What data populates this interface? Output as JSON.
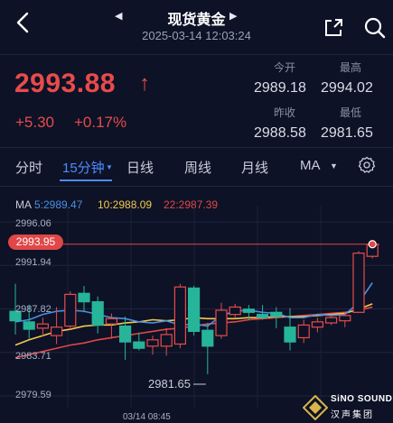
{
  "header": {
    "title": "现货黄金",
    "datetime": "2025-03-14 12:03:24",
    "icons": [
      "back-icon",
      "prev-triangle-icon",
      "next-triangle-icon",
      "share-icon",
      "search-icon"
    ]
  },
  "quote": {
    "price": "2993.88",
    "arrow": "↑",
    "change": "+5.30",
    "change_pct": "+0.17%",
    "up_color": "#e84b4b",
    "open_label": "今开",
    "open_value": "2989.18",
    "high_label": "最高",
    "high_value": "2994.02",
    "prev_close_label": "昨收",
    "prev_close_value": "2988.58",
    "low_label": "最低",
    "low_value": "2981.65"
  },
  "tabs": [
    {
      "label": "分时",
      "active": false
    },
    {
      "label": "15分钟",
      "active": true
    },
    {
      "label": "日线",
      "active": false
    },
    {
      "label": "周线",
      "active": false
    },
    {
      "label": "月线",
      "active": false
    },
    {
      "label": "MA",
      "active": false
    }
  ],
  "settings_icon": "gear-icon",
  "ma_legend": {
    "ma": "MA",
    "ma5": "5:2989.47",
    "ma10": "10:2988.09",
    "ma22": "22:2987.39",
    "colors": {
      "ma5": "#4a90e2",
      "ma10": "#f2c94c",
      "ma22": "#e14747"
    }
  },
  "chart_data": {
    "type": "candlestick",
    "y_ticks": [
      "2996.06",
      "2991.94",
      "2987.82",
      "2983.71",
      "2979.59"
    ],
    "ylim": [
      2979.59,
      2996.06
    ],
    "current_price_label": "2993.95",
    "current_price": 2993.95,
    "low_annotation": "2981.65",
    "x_label": "03/14 08:45",
    "up_color": "#e84b4b",
    "down_color": "#27b59a",
    "candles": [
      {
        "o": 2987.6,
        "h": 2990.2,
        "l": 2985.4,
        "c": 2986.7
      },
      {
        "o": 2986.6,
        "h": 2988.2,
        "l": 2985.0,
        "c": 2985.9
      },
      {
        "o": 2986.0,
        "h": 2987.0,
        "l": 2985.2,
        "c": 2986.4
      },
      {
        "o": 2985.3,
        "h": 2988.0,
        "l": 2984.5,
        "c": 2986.1
      },
      {
        "o": 2986.2,
        "h": 2989.5,
        "l": 2985.9,
        "c": 2989.2
      },
      {
        "o": 2989.3,
        "h": 2990.0,
        "l": 2987.5,
        "c": 2988.5
      },
      {
        "o": 2988.5,
        "h": 2989.0,
        "l": 2985.5,
        "c": 2986.3
      },
      {
        "o": 2986.4,
        "h": 2987.4,
        "l": 2985.0,
        "c": 2986.9
      },
      {
        "o": 2986.2,
        "h": 2987.1,
        "l": 2983.0,
        "c": 2984.7
      },
      {
        "o": 2984.7,
        "h": 2985.6,
        "l": 2983.9,
        "c": 2984.1
      },
      {
        "o": 2984.3,
        "h": 2985.3,
        "l": 2983.5,
        "c": 2984.9
      },
      {
        "o": 2984.3,
        "h": 2986.0,
        "l": 2983.4,
        "c": 2985.4
      },
      {
        "o": 2984.5,
        "h": 2990.2,
        "l": 2984.1,
        "c": 2989.9
      },
      {
        "o": 2989.8,
        "h": 2990.0,
        "l": 2985.3,
        "c": 2985.7
      },
      {
        "o": 2985.8,
        "h": 2986.5,
        "l": 2981.65,
        "c": 2984.3
      },
      {
        "o": 2985.3,
        "h": 2988.4,
        "l": 2985.0,
        "c": 2987.7
      },
      {
        "o": 2987.3,
        "h": 2988.3,
        "l": 2987.0,
        "c": 2988.0
      },
      {
        "o": 2987.8,
        "h": 2988.2,
        "l": 2986.8,
        "c": 2987.5
      },
      {
        "o": 2987.3,
        "h": 2988.2,
        "l": 2986.8,
        "c": 2987.0
      },
      {
        "o": 2987.5,
        "h": 2988.0,
        "l": 2986.0,
        "c": 2987.1
      },
      {
        "o": 2986.1,
        "h": 2987.9,
        "l": 2983.9,
        "c": 2984.7
      },
      {
        "o": 2985.1,
        "h": 2986.8,
        "l": 2984.6,
        "c": 2986.3
      },
      {
        "o": 2986.1,
        "h": 2987.0,
        "l": 2985.6,
        "c": 2986.6
      },
      {
        "o": 2986.5,
        "h": 2987.3,
        "l": 2986.3,
        "c": 2987.0
      },
      {
        "o": 2986.7,
        "h": 2987.5,
        "l": 2986.1,
        "c": 2987.2
      },
      {
        "o": 2987.5,
        "h": 2993.3,
        "l": 2987.5,
        "c": 2993.1
      },
      {
        "o": 2992.8,
        "h": 2994.02,
        "l": 2992.6,
        "c": 2993.9
      }
    ],
    "ma5": [
      2986.6,
      2986.8,
      2987.3,
      2987.6,
      2987.7,
      2987.6,
      2987.3,
      2987.0,
      2986.9,
      2986.6,
      2986.5,
      2986.7,
      2986.3,
      2986.4,
      2986.2,
      2987.2,
      2987.6,
      2987.7,
      2987.5,
      2987.4,
      2987.0,
      2987.0,
      2987.3,
      2987.2,
      2987.3,
      2988.4,
      2990.3
    ],
    "ma10": [
      2984.4,
      2984.9,
      2985.3,
      2985.7,
      2985.9,
      2986.2,
      2986.3,
      2986.3,
      2986.5,
      2986.6,
      2986.8,
      2986.7,
      2986.8,
      2987.0,
      2986.9,
      2986.9,
      2986.9,
      2987.0,
      2987.0,
      2987.1,
      2987.1,
      2987.1,
      2987.2,
      2987.3,
      2987.4,
      2987.8,
      2988.3
    ],
    "ma22": [
      2983.2,
      2983.5,
      2983.8,
      2984.1,
      2984.4,
      2984.6,
      2984.9,
      2985.1,
      2985.3,
      2985.5,
      2985.7,
      2985.9,
      2986.0,
      2986.2,
      2986.4,
      2986.5,
      2986.6,
      2986.8,
      2986.9,
      2987.0,
      2987.1,
      2987.2,
      2987.3,
      2987.4,
      2987.5,
      2987.7,
      2988.0
    ]
  },
  "brand": {
    "en": "SiNO SOUND",
    "cn": "汉声集团",
    "logo_icon": "diamond-logo-icon"
  }
}
